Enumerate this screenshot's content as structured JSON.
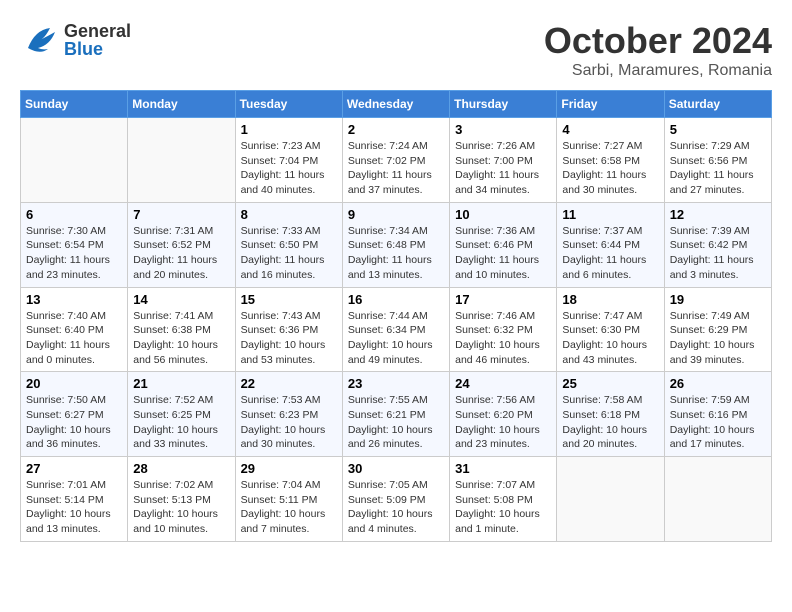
{
  "header": {
    "logo_general": "General",
    "logo_blue": "Blue",
    "month": "October 2024",
    "location": "Sarbi, Maramures, Romania"
  },
  "weekdays": [
    "Sunday",
    "Monday",
    "Tuesday",
    "Wednesday",
    "Thursday",
    "Friday",
    "Saturday"
  ],
  "weeks": [
    [
      {
        "day": "",
        "info": ""
      },
      {
        "day": "",
        "info": ""
      },
      {
        "day": "1",
        "info": "Sunrise: 7:23 AM\nSunset: 7:04 PM\nDaylight: 11 hours and 40 minutes."
      },
      {
        "day": "2",
        "info": "Sunrise: 7:24 AM\nSunset: 7:02 PM\nDaylight: 11 hours and 37 minutes."
      },
      {
        "day": "3",
        "info": "Sunrise: 7:26 AM\nSunset: 7:00 PM\nDaylight: 11 hours and 34 minutes."
      },
      {
        "day": "4",
        "info": "Sunrise: 7:27 AM\nSunset: 6:58 PM\nDaylight: 11 hours and 30 minutes."
      },
      {
        "day": "5",
        "info": "Sunrise: 7:29 AM\nSunset: 6:56 PM\nDaylight: 11 hours and 27 minutes."
      }
    ],
    [
      {
        "day": "6",
        "info": "Sunrise: 7:30 AM\nSunset: 6:54 PM\nDaylight: 11 hours and 23 minutes."
      },
      {
        "day": "7",
        "info": "Sunrise: 7:31 AM\nSunset: 6:52 PM\nDaylight: 11 hours and 20 minutes."
      },
      {
        "day": "8",
        "info": "Sunrise: 7:33 AM\nSunset: 6:50 PM\nDaylight: 11 hours and 16 minutes."
      },
      {
        "day": "9",
        "info": "Sunrise: 7:34 AM\nSunset: 6:48 PM\nDaylight: 11 hours and 13 minutes."
      },
      {
        "day": "10",
        "info": "Sunrise: 7:36 AM\nSunset: 6:46 PM\nDaylight: 11 hours and 10 minutes."
      },
      {
        "day": "11",
        "info": "Sunrise: 7:37 AM\nSunset: 6:44 PM\nDaylight: 11 hours and 6 minutes."
      },
      {
        "day": "12",
        "info": "Sunrise: 7:39 AM\nSunset: 6:42 PM\nDaylight: 11 hours and 3 minutes."
      }
    ],
    [
      {
        "day": "13",
        "info": "Sunrise: 7:40 AM\nSunset: 6:40 PM\nDaylight: 11 hours and 0 minutes."
      },
      {
        "day": "14",
        "info": "Sunrise: 7:41 AM\nSunset: 6:38 PM\nDaylight: 10 hours and 56 minutes."
      },
      {
        "day": "15",
        "info": "Sunrise: 7:43 AM\nSunset: 6:36 PM\nDaylight: 10 hours and 53 minutes."
      },
      {
        "day": "16",
        "info": "Sunrise: 7:44 AM\nSunset: 6:34 PM\nDaylight: 10 hours and 49 minutes."
      },
      {
        "day": "17",
        "info": "Sunrise: 7:46 AM\nSunset: 6:32 PM\nDaylight: 10 hours and 46 minutes."
      },
      {
        "day": "18",
        "info": "Sunrise: 7:47 AM\nSunset: 6:30 PM\nDaylight: 10 hours and 43 minutes."
      },
      {
        "day": "19",
        "info": "Sunrise: 7:49 AM\nSunset: 6:29 PM\nDaylight: 10 hours and 39 minutes."
      }
    ],
    [
      {
        "day": "20",
        "info": "Sunrise: 7:50 AM\nSunset: 6:27 PM\nDaylight: 10 hours and 36 minutes."
      },
      {
        "day": "21",
        "info": "Sunrise: 7:52 AM\nSunset: 6:25 PM\nDaylight: 10 hours and 33 minutes."
      },
      {
        "day": "22",
        "info": "Sunrise: 7:53 AM\nSunset: 6:23 PM\nDaylight: 10 hours and 30 minutes."
      },
      {
        "day": "23",
        "info": "Sunrise: 7:55 AM\nSunset: 6:21 PM\nDaylight: 10 hours and 26 minutes."
      },
      {
        "day": "24",
        "info": "Sunrise: 7:56 AM\nSunset: 6:20 PM\nDaylight: 10 hours and 23 minutes."
      },
      {
        "day": "25",
        "info": "Sunrise: 7:58 AM\nSunset: 6:18 PM\nDaylight: 10 hours and 20 minutes."
      },
      {
        "day": "26",
        "info": "Sunrise: 7:59 AM\nSunset: 6:16 PM\nDaylight: 10 hours and 17 minutes."
      }
    ],
    [
      {
        "day": "27",
        "info": "Sunrise: 7:01 AM\nSunset: 5:14 PM\nDaylight: 10 hours and 13 minutes."
      },
      {
        "day": "28",
        "info": "Sunrise: 7:02 AM\nSunset: 5:13 PM\nDaylight: 10 hours and 10 minutes."
      },
      {
        "day": "29",
        "info": "Sunrise: 7:04 AM\nSunset: 5:11 PM\nDaylight: 10 hours and 7 minutes."
      },
      {
        "day": "30",
        "info": "Sunrise: 7:05 AM\nSunset: 5:09 PM\nDaylight: 10 hours and 4 minutes."
      },
      {
        "day": "31",
        "info": "Sunrise: 7:07 AM\nSunset: 5:08 PM\nDaylight: 10 hours and 1 minute."
      },
      {
        "day": "",
        "info": ""
      },
      {
        "day": "",
        "info": ""
      }
    ]
  ]
}
